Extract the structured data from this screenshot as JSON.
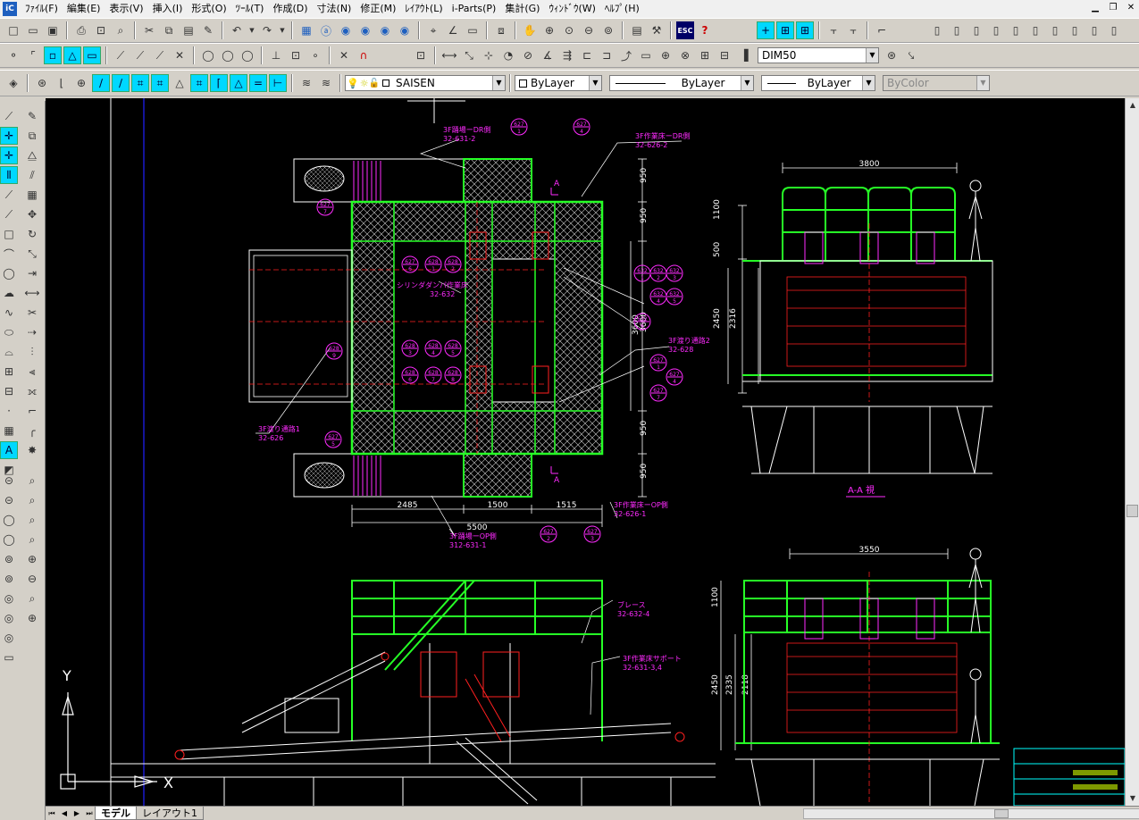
{
  "menu": {
    "items": [
      "ﾌｧｲﾙ(F)",
      "編集(E)",
      "表示(V)",
      "挿入(I)",
      "形式(O)",
      "ﾂｰﾙ(T)",
      "作成(D)",
      "寸法(N)",
      "修正(M)",
      "ﾚｲｱｳﾄ(L)",
      "i-Parts(P)",
      "集計(G)",
      "ｳｨﾝﾄﾞｳ(W)",
      "ﾍﾙﾌﾟ(H)"
    ]
  },
  "toolbar": {
    "dimstyle": "DIM50",
    "layer": "SAISEN",
    "color": "ByLayer",
    "linetype": "ByLayer",
    "lineweight": "ByLayer",
    "plotstyle": "ByColor",
    "esc_label": "ESC",
    "help_label": "?"
  },
  "tabs": [
    "モデル",
    "レイアウト1"
  ],
  "drawing": {
    "callouts": {
      "top_dr": [
        "3F踊場ーDR側",
        "32-631-2"
      ],
      "work_dr": [
        "3F作業床ーDR側",
        "32-626-2"
      ],
      "cylinder": [
        "シリンダダンパ作業床",
        "32-632"
      ],
      "bridge2": [
        "3F渡り通路2",
        "32-628"
      ],
      "bridge1": [
        "3F渡り通路1",
        "32-626"
      ],
      "work_op": [
        "3F作業床ーOP側",
        "32-626-1"
      ],
      "landing_op": [
        "3F踊場ーOP側",
        "312-631-1"
      ],
      "brace": [
        "ブレース",
        "32-632-4"
      ],
      "support": [
        "3F作業床サポート",
        "32-631-3,4"
      ]
    },
    "dims": {
      "plan_bottom": [
        "2485",
        "1500",
        "1515"
      ],
      "plan_total": "5500",
      "plan_right": [
        "950",
        "950",
        "3600",
        "950",
        "950"
      ],
      "plan_inner": "3600",
      "section_top": "3800",
      "section_side": [
        "1100",
        "500",
        "2450",
        "2316"
      ],
      "section2_top": "3550",
      "section2_side": [
        "1100",
        "2450",
        "2335",
        "2118"
      ]
    },
    "section_label": "A-A 視",
    "section_mark": "A",
    "balloons": [
      "627\n1",
      "627\n4",
      "627\n7",
      "627\n2",
      "627\n3",
      "627\n5",
      "627\n6",
      "628\n1",
      "628\n2",
      "628\n3",
      "628\n4",
      "628\n5",
      "628\n6",
      "628\n7",
      "628\n8",
      "628\n9",
      "632\n1",
      "632\n2",
      "632\n3",
      "632\n4",
      "632\n5",
      "632\n6"
    ],
    "ucs": {
      "x": "X",
      "y": "Y"
    }
  },
  "colors": {
    "canvas": "#000000",
    "green": "#26ff26",
    "magenta": "#ff2bff",
    "white": "#ffffff",
    "red": "#ff2020",
    "cyan": "#00ffff",
    "blue": "#2020ff"
  }
}
